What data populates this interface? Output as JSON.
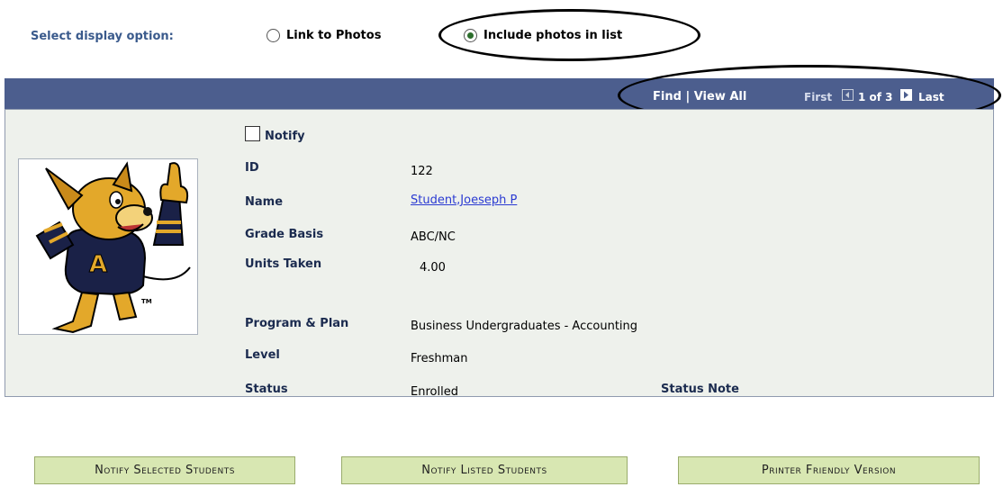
{
  "display_option": {
    "label": "Select display option:",
    "options": [
      {
        "label": "Link to Photos",
        "selected": false
      },
      {
        "label": "Include photos in list",
        "selected": true
      }
    ]
  },
  "navigation": {
    "find": "Find",
    "separator": "|",
    "view_all": "View All",
    "first": "First",
    "page_info": "1 of 3",
    "last": "Last"
  },
  "record": {
    "notify_label": "Notify",
    "notify_checked": false,
    "fields": {
      "id_label": "ID",
      "id_value": "122",
      "name_label": "Name",
      "name_value": "Student,Joeseph P",
      "grade_basis_label": "Grade Basis",
      "grade_basis_value": "ABC/NC",
      "units_taken_label": "Units Taken",
      "units_taken_value": "4.00",
      "program_plan_label": "Program & Plan",
      "program_plan_value": "Business Undergraduates - Accounting",
      "level_label": "Level",
      "level_value": "Freshman",
      "status_label": "Status",
      "status_value": "Enrolled",
      "status_note_label": "Status Note"
    },
    "photo_mascot_letter": "A",
    "photo_tm": "TM"
  },
  "buttons": {
    "notify_selected": "Notify Selected Students",
    "notify_listed": "Notify Listed Students",
    "printer_friendly": "Printer Friendly Version"
  },
  "colors": {
    "header_bar": "#4c5e8e",
    "panel_bg": "#eef1ec",
    "button_bg": "#d8e7b2",
    "label_blue": "#3a5a8c",
    "link_blue": "#2a3ad2"
  }
}
